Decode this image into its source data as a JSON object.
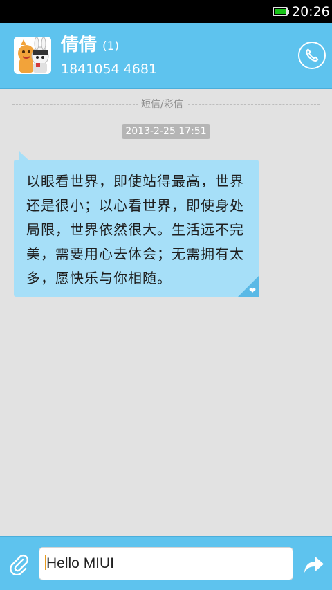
{
  "status_bar": {
    "time": "20:26",
    "battery_level": 1.0,
    "battery_color": "#19c419"
  },
  "header": {
    "contact_name": "倩倩",
    "unread_count": "(1)",
    "phone_number": "1841054 4681",
    "avatar_icon": "cartoon-avatar-icon",
    "call_icon": "phone-icon",
    "background_color": "#5ec3ee"
  },
  "conversation": {
    "divider_label": "短信/彩信",
    "timestamp": "2013-2-25 17:51",
    "messages": [
      {
        "text": "以眼看世界，即使站得最高，世界还是很小；以心看世界，即使身处局限，世界依然很大。生活远不完美，需要用心去体会；无需拥有太多，愿快乐与你相随。",
        "direction": "incoming",
        "bubble_color": "#a6dff8",
        "corner_icon": "heart-icon"
      }
    ]
  },
  "composer": {
    "input_value": "Hello MIUI",
    "attach_icon": "paperclip-icon",
    "send_icon": "send-arrow-icon"
  }
}
